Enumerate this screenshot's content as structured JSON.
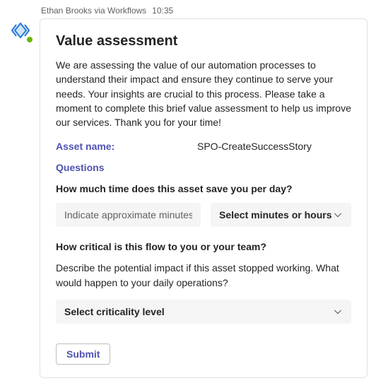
{
  "header": {
    "sender": "Ethan Brooks via Workflows",
    "time": "10:35"
  },
  "card": {
    "title": "Value assessment",
    "description": "We are assessing the value of our automation processes to understand their impact and ensure they continue to serve your needs. Your insights are crucial to this process. Please take a moment to complete this brief value assessment to help us improve our services. Thank you for your time!",
    "asset_label": "Asset name:",
    "asset_value": "SPO-CreateSuccessStory",
    "questions_label": "Questions",
    "q1": {
      "text": "How much time does this asset save you per day?",
      "input_placeholder": "Indicate approximate minutes",
      "select_placeholder": "Select minutes or hours"
    },
    "q2": {
      "text": "How critical is this flow to you or your team?",
      "desc": "Describe the potential impact if this asset stopped working. What would happen to your daily operations?",
      "select_placeholder": "Select criticality level"
    },
    "submit_label": "Submit"
  }
}
